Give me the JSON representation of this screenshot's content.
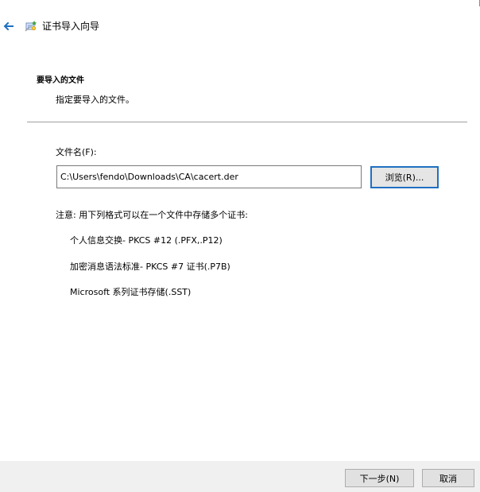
{
  "window": {
    "title": "证书导入向导"
  },
  "header": {
    "section_title": "要导入的文件",
    "section_subtitle": "指定要导入的文件。"
  },
  "form": {
    "filename_label": "文件名(F):",
    "filename_value": "C:\\Users\\fendo\\Downloads\\CA\\cacert.der",
    "browse_label": "浏览(R)..."
  },
  "note": {
    "text": "注意: 用下列格式可以在一个文件中存储多个证书:",
    "formats": [
      "个人信息交换- PKCS #12 (.PFX,.P12)",
      "加密消息语法标准- PKCS #7 证书(.P7B)",
      "Microsoft 系列证书存储(.SST)"
    ]
  },
  "footer": {
    "next_label": "下一步(N)",
    "cancel_label": "取消"
  },
  "icons": {
    "back": "back-arrow-icon",
    "app": "certificate-wizard-icon"
  },
  "colors": {
    "accent": "#1f70c1",
    "footer_bg": "#f0f0f0"
  }
}
